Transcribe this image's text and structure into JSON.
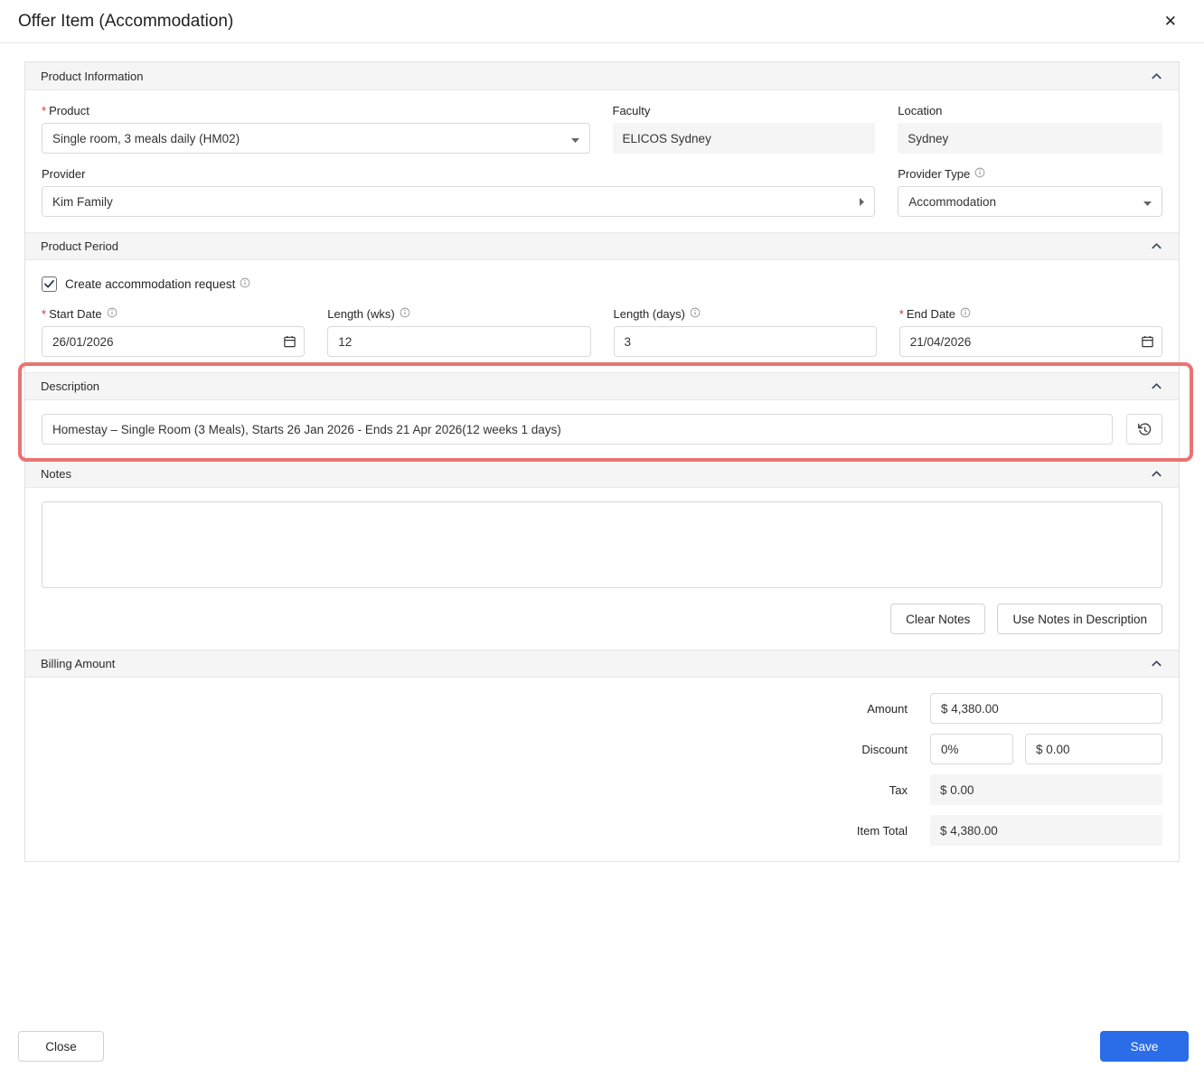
{
  "modal": {
    "title": "Offer Item (Accommodation)",
    "close_icon": "✕"
  },
  "misc": {
    "required_mark": "*"
  },
  "product_information": {
    "title": "Product Information",
    "product_label": "Product",
    "product_value": "Single room, 3 meals daily (HM02)",
    "faculty_label": "Faculty",
    "faculty_value": "ELICOS Sydney",
    "location_label": "Location",
    "location_value": "Sydney",
    "provider_label": "Provider",
    "provider_value": "Kim Family",
    "provider_type_label": "Provider Type",
    "provider_type_value": "Accommodation"
  },
  "product_period": {
    "title": "Product Period",
    "create_request_label": "Create accommodation request",
    "create_request_checked": true,
    "start_date_label": "Start Date",
    "start_date_value": "26/01/2026",
    "length_wks_label": "Length (wks)",
    "length_wks_value": "12",
    "length_days_label": "Length (days)",
    "length_days_value": "3",
    "end_date_label": "End Date",
    "end_date_value": "21/04/2026"
  },
  "description": {
    "title": "Description",
    "value": "Homestay – Single Room (3 Meals), Starts 26 Jan 2026 - Ends 21 Apr 2026(12 weeks 1 days)"
  },
  "notes": {
    "title": "Notes",
    "value": "",
    "clear_label": "Clear Notes",
    "use_label": "Use Notes in Description"
  },
  "billing": {
    "title": "Billing Amount",
    "amount_label": "Amount",
    "amount_value": "$ 4,380.00",
    "discount_label": "Discount",
    "discount_percent_value": "0%",
    "discount_amount_value": "$ 0.00",
    "tax_label": "Tax",
    "tax_value": "$ 0.00",
    "item_total_label": "Item Total",
    "item_total_value": "$ 4,380.00"
  },
  "footer": {
    "close_label": "Close",
    "save_label": "Save"
  },
  "colors": {
    "accent_blue": "#2b6de8",
    "annotation_red": "#e87472",
    "required_red": "#e02b2b",
    "section_header_bg": "#f5f5f5",
    "readonly_bg": "#f5f5f5"
  }
}
